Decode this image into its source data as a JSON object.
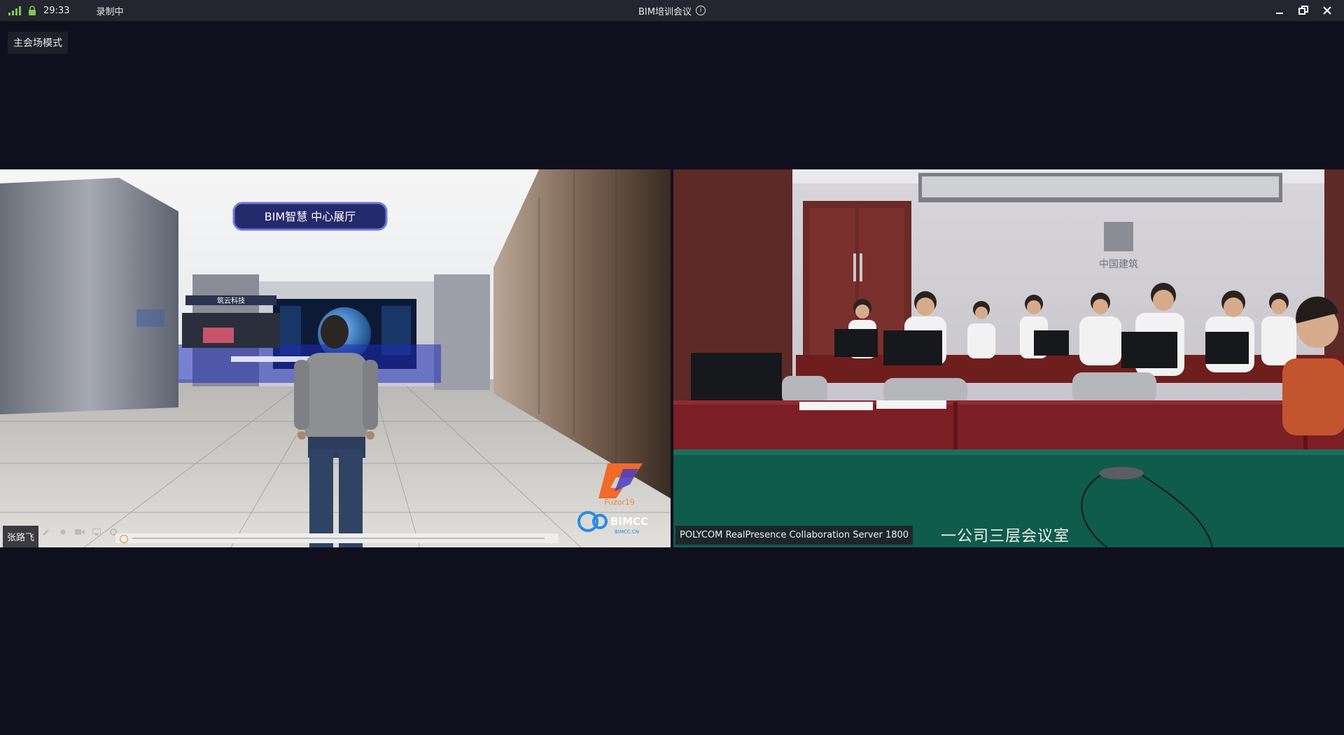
{
  "titlebar": {
    "timer": "29:33",
    "recording": "录制中",
    "title": "BIM培训会议"
  },
  "mode": {
    "label": "主会场模式"
  },
  "left_video": {
    "participant": "张路飞",
    "sign_text": "BIM智慧  中心展厅",
    "booth_text": "筑云科技",
    "brand_fuzor": "Fuzor19",
    "brand_bimcc": "BIMCC",
    "brand_bimcc_sub": "BIMCC.CN"
  },
  "right_video": {
    "server_label": "POLYCOM RealPresence Collaboration Server 1800",
    "room_name": "一公司三层会议室",
    "wall_logo_text": "中国建筑"
  },
  "colors": {
    "background": "#0f0f1e",
    "titlebar": "#23262f",
    "signal": "#7ec850",
    "lock": "#7ec850"
  }
}
